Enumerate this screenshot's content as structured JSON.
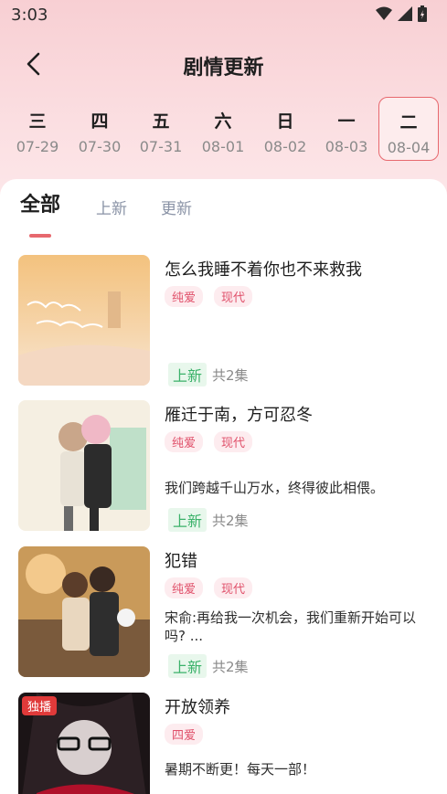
{
  "status_bar": {
    "time": "3:03"
  },
  "header": {
    "title": "剧情更新"
  },
  "days": [
    {
      "weekday": "三",
      "date": "07-29"
    },
    {
      "weekday": "四",
      "date": "07-30"
    },
    {
      "weekday": "五",
      "date": "07-31"
    },
    {
      "weekday": "六",
      "date": "08-01"
    },
    {
      "weekday": "日",
      "date": "08-02"
    },
    {
      "weekday": "一",
      "date": "08-03"
    },
    {
      "weekday": "二",
      "date": "08-04"
    }
  ],
  "selected_day": "08-04",
  "tabs": [
    {
      "label": "全部"
    },
    {
      "label": "上新"
    },
    {
      "label": "更新"
    }
  ],
  "items": [
    {
      "title": "怎么我睡不着你也不来救我",
      "tags": [
        "纯爱",
        "现代"
      ],
      "desc": "",
      "status": "上新",
      "episodes": "共2集"
    },
    {
      "title": "雁迁于南，方可忍冬",
      "tags": [
        "纯爱",
        "现代"
      ],
      "desc": "我们跨越千山万水，终得彼此相偎。",
      "status": "上新",
      "episodes": "共2集"
    },
    {
      "title": "犯错",
      "tags": [
        "纯爱",
        "现代"
      ],
      "desc": "宋俞:再给我一次机会，我们重新开始可以吗? ...",
      "status": "上新",
      "episodes": "共2集"
    },
    {
      "title": "开放领养",
      "tags": [
        "四爱"
      ],
      "desc": "暑期不断更！每天一部！",
      "badge": "独播"
    }
  ],
  "colors": {
    "accent": "#e7686e",
    "tag_text": "#e0506a",
    "new_badge": "#3bb26a"
  }
}
